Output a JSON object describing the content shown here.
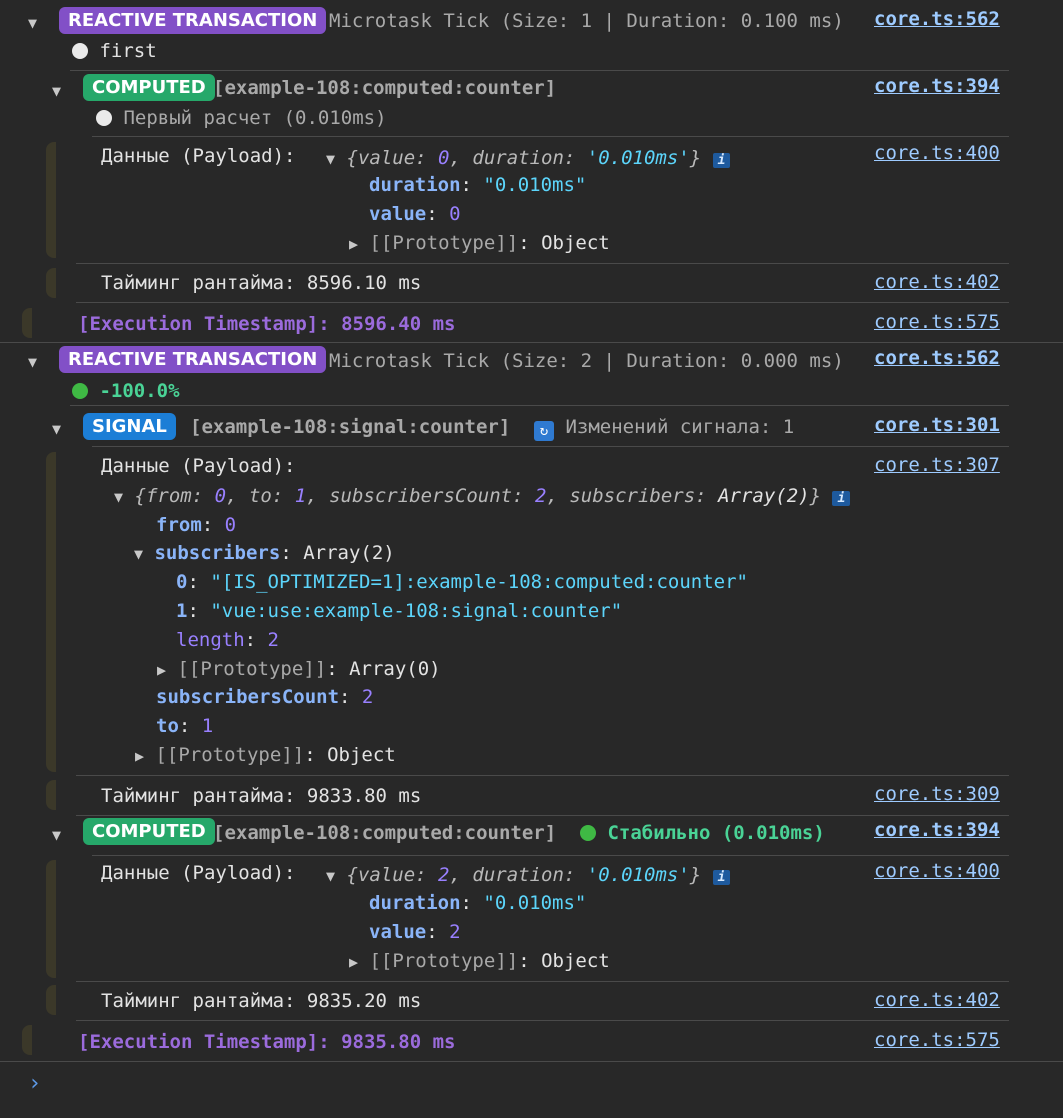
{
  "tx1": {
    "badge": "REACTIVE TRANSACTION",
    "desc": "Microtask Tick (Size: 1 | Duration: 0.100 ms)",
    "link": "core.ts:562",
    "status": "first",
    "computed": {
      "badge": "COMPUTED",
      "name": "[example-108:computed:counter]",
      "link": "core.ts:394",
      "status": "Первый расчет (0.010ms)",
      "payload_label": "Данные (Payload):",
      "payload_link": "core.ts:400",
      "summary": {
        "open": "{",
        "k1": "value",
        "v1": "0",
        "k2": "duration",
        "v2": "'0.010ms'",
        "close": "}"
      },
      "duration_key": "duration",
      "duration_val": "\"0.010ms\"",
      "value_key": "value",
      "value_val": "0",
      "proto_key": "[[Prototype]]",
      "proto_val": "Object",
      "timing": "Тайминг рантайма: 8596.10 ms",
      "timing_link": "core.ts:402"
    },
    "timestamp": "[Execution Timestamp]: 8596.40 ms",
    "timestamp_link": "core.ts:575"
  },
  "tx2": {
    "badge": "REACTIVE TRANSACTION",
    "desc": "Microtask Tick (Size: 2 | Duration: 0.000 ms)",
    "link": "core.ts:562",
    "status": "-100.0%",
    "signal": {
      "badge": "SIGNAL",
      "name": "[example-108:signal:counter]",
      "changes": "Изменений сигнала: 1",
      "link": "core.ts:301",
      "payload_label": "Данные (Payload):",
      "payload_link": "core.ts:307",
      "summary": {
        "open": "{",
        "k1": "from",
        "v1": "0",
        "k2": "to",
        "v2": "1",
        "k3": "subscribersCount",
        "v3": "2",
        "k4": "subscribers",
        "v4": "Array(2)",
        "close": "}"
      },
      "from_key": "from",
      "from_val": "0",
      "subs_key": "subscribers",
      "subs_val": "Array(2)",
      "sub0_key": "0",
      "sub0_val": "\"[IS_OPTIMIZED=1]:example-108:computed:counter\"",
      "sub1_key": "1",
      "sub1_val": "\"vue:use:example-108:signal:counter\"",
      "len_key": "length",
      "len_val": "2",
      "arr_proto_key": "[[Prototype]]",
      "arr_proto_val": "Array(0)",
      "count_key": "subscribersCount",
      "count_val": "2",
      "to_key": "to",
      "to_val": "1",
      "proto_key": "[[Prototype]]",
      "proto_val": "Object",
      "timing": "Тайминг рантайма: 9833.80 ms",
      "timing_link": "core.ts:309"
    },
    "computed": {
      "badge": "COMPUTED",
      "name": "[example-108:computed:counter]",
      "status": "Стабильно (0.010ms)",
      "link": "core.ts:394",
      "payload_label": "Данные (Payload):",
      "payload_link": "core.ts:400",
      "summary": {
        "open": "{",
        "k1": "value",
        "v1": "2",
        "k2": "duration",
        "v2": "'0.010ms'",
        "close": "}"
      },
      "duration_key": "duration",
      "duration_val": "\"0.010ms\"",
      "value_key": "value",
      "value_val": "2",
      "proto_key": "[[Prototype]]",
      "proto_val": "Object",
      "timing": "Тайминг рантайма: 9835.20 ms",
      "timing_link": "core.ts:402"
    },
    "timestamp": "[Execution Timestamp]: 9835.80 ms",
    "timestamp_link": "core.ts:575"
  },
  "info_glyph": "i",
  "prompt_glyph": "›",
  "colors": {
    "background": "#282828",
    "transaction_badge": "#8250c7",
    "computed_badge": "#26a86a",
    "signal_badge": "#1c7ed6",
    "link": "#9ecbff",
    "timestamp": "#9b6bdc",
    "stable": "#4ad396"
  },
  "icons": {
    "expand": "triangle-down-icon",
    "collapsed": "triangle-right-icon",
    "status_white": "white-circle-icon",
    "status_green": "green-circle-icon",
    "refresh": "refresh-icon",
    "info": "info-icon",
    "prompt": "chevron-right-icon"
  }
}
